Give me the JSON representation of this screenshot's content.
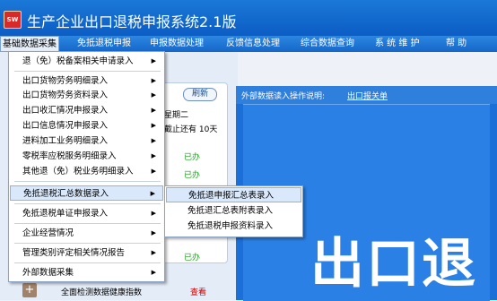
{
  "app": {
    "icon_text": "SW",
    "title": "生产企业出口退税申报系统2.1版"
  },
  "menubar": {
    "items": [
      {
        "label": "基础数据采集"
      },
      {
        "label": "免抵退税申报"
      },
      {
        "label": "申报数据处理"
      },
      {
        "label": "反馈信息处理"
      },
      {
        "label": "综合数据查询"
      },
      {
        "label": "系 统 维 护"
      },
      {
        "label": "帮  助"
      }
    ]
  },
  "dropdown": {
    "items": [
      {
        "label": "退（免）税备案相关申请录入"
      },
      {
        "label": "出口货物劳务明细录入"
      },
      {
        "label": "出口货物劳务资料录入"
      },
      {
        "label": "出口收汇情况申报录入"
      },
      {
        "label": "出口信息情况申报录入"
      },
      {
        "label": "进料加工业务明细录入"
      },
      {
        "label": "零税率应税服务明细录入"
      },
      {
        "label": "其他退（免）税业务明细录入"
      },
      {
        "label": "免抵退税汇总数据录入"
      },
      {
        "label": "免抵退税单证申报录入"
      },
      {
        "label": "企业经营情况"
      },
      {
        "label": "管理类别评定相关情况报告"
      },
      {
        "label": "外部数据采集"
      }
    ],
    "arrow_glyph": "▶"
  },
  "submenu": {
    "items": [
      {
        "label": "免抵退申报汇总表录入"
      },
      {
        "label": "免抵退汇总表附表录入"
      },
      {
        "label": "免抵退税申报资料录入"
      }
    ]
  },
  "background": {
    "refresh_label": "刷新",
    "weekday_text": "星期二",
    "deadline_text": "截止还有 10天",
    "done_1": "已办",
    "done_2": "已办",
    "done_3": "已办",
    "health_icon_glyph": "+",
    "health_label": "全面检测数据健康指数",
    "health_link": "查看"
  },
  "right_panel": {
    "header_label": "外部数据读入操作说明:",
    "header_link": "出口报关单",
    "big_text": "出口退"
  },
  "colors": {
    "title_bar": "#1a78d8",
    "menu_bar": "#1567c8",
    "highlight": "#d9e8fb",
    "right_panel": "#1c6fd6",
    "done_text": "#1fa01f"
  }
}
